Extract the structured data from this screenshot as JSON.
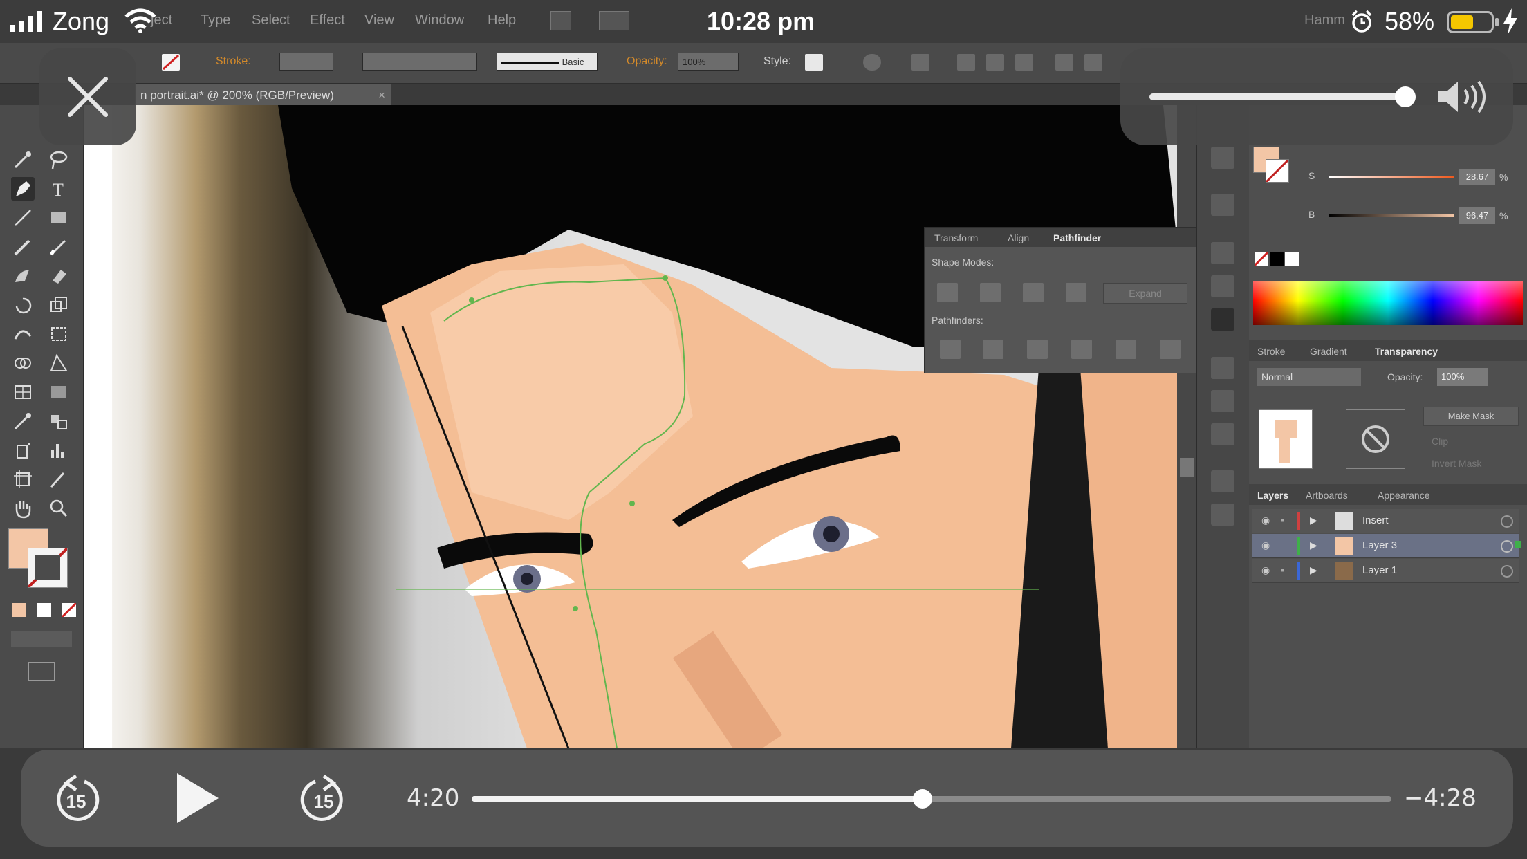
{
  "status_bar": {
    "carrier": "Zong",
    "time": "10:28 pm",
    "battery_percent": "58%",
    "battery_level": 0.58,
    "faded_label": "Hamm"
  },
  "app": {
    "menu": [
      "ject",
      "Type",
      "Select",
      "Effect",
      "View",
      "Window",
      "Help"
    ],
    "control_bar": {
      "stroke_label": "Stroke:",
      "brush_label": "Basic",
      "opacity_label": "Opacity:",
      "opacity_value": "100%",
      "style_label": "Style:"
    },
    "document_tab": "n portrait.ai* @ 200% (RGB/Preview)",
    "pathfinder_panel": {
      "tabs": [
        "Transform",
        "Align",
        "Pathfinder"
      ],
      "active_tab": "Pathfinder",
      "shape_modes_label": "Shape Modes:",
      "expand_label": "Expand",
      "pathfinders_label": "Pathfinders:"
    },
    "color_panel": {
      "s_label": "S",
      "s_value": "28.67",
      "b_label": "B",
      "b_value": "96.47",
      "unit": "%"
    },
    "transparency_panel": {
      "tabs": [
        "Stroke",
        "Gradient",
        "Transparency"
      ],
      "active_tab": "Transparency",
      "blend_mode": "Normal",
      "opacity_label": "Opacity:",
      "opacity_value": "100%",
      "make_mask": "Make Mask",
      "clip": "Clip",
      "invert_mask": "Invert Mask"
    },
    "layers_panel": {
      "tabs": [
        "Layers",
        "Artboards",
        "Appearance"
      ],
      "active_tab": "Layers",
      "layers": [
        {
          "name": "Insert",
          "color": "#d04040",
          "selected": false
        },
        {
          "name": "Layer 3",
          "color": "#3fb04a",
          "selected": true
        },
        {
          "name": "Layer 1",
          "color": "#3b67d6",
          "selected": false
        }
      ]
    }
  },
  "player": {
    "elapsed": "4:20",
    "remaining": "−4:28",
    "progress": 0.49,
    "skip_back_label": "15",
    "skip_forward_label": "15",
    "volume_level": 1.0
  }
}
